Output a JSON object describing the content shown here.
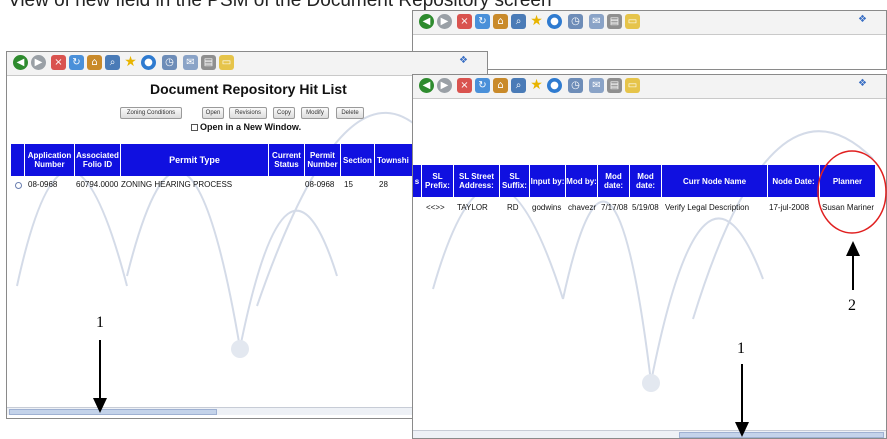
{
  "caption": "View of new field in the PSM of the Document Repository screen",
  "window_left": {
    "title": "Document Repository Hit List",
    "buttons": [
      "Zoning Conditions",
      "Open",
      "Revisions",
      "Copy",
      "Modify",
      "Delete"
    ],
    "open_new_window_label": "Open in a New Window.",
    "columns": [
      "Application Number",
      "Associated Folio ID",
      "Permit Type",
      "Current Status",
      "Permit Number",
      "Section",
      "Townshi"
    ],
    "row": [
      "08-0968",
      "60794.0000",
      "ZONING HEARING PROCESS",
      "",
      "08-0968",
      "15",
      "28"
    ]
  },
  "window_right": {
    "columns": [
      "s",
      "SL Prefix:",
      "SL Street Address:",
      "SL Suffix:",
      "Input by:",
      "Mod by:",
      "Mod date:",
      "Mod date:",
      "Curr Node Name",
      "Node Date:",
      "Planner"
    ],
    "row": [
      "<<>>",
      "TAYLOR",
      "RD",
      "godwins",
      "chavezr",
      "7/17/08",
      "5/19/08",
      "Verify Legal Description",
      "17-jul-2008",
      "Susan Mariner"
    ]
  },
  "annotations": {
    "marker_left": "1",
    "marker_right": "1",
    "marker_planner": "2",
    "circle_color": "#e02020"
  },
  "colors": {
    "header_blue": "#1010e0"
  }
}
